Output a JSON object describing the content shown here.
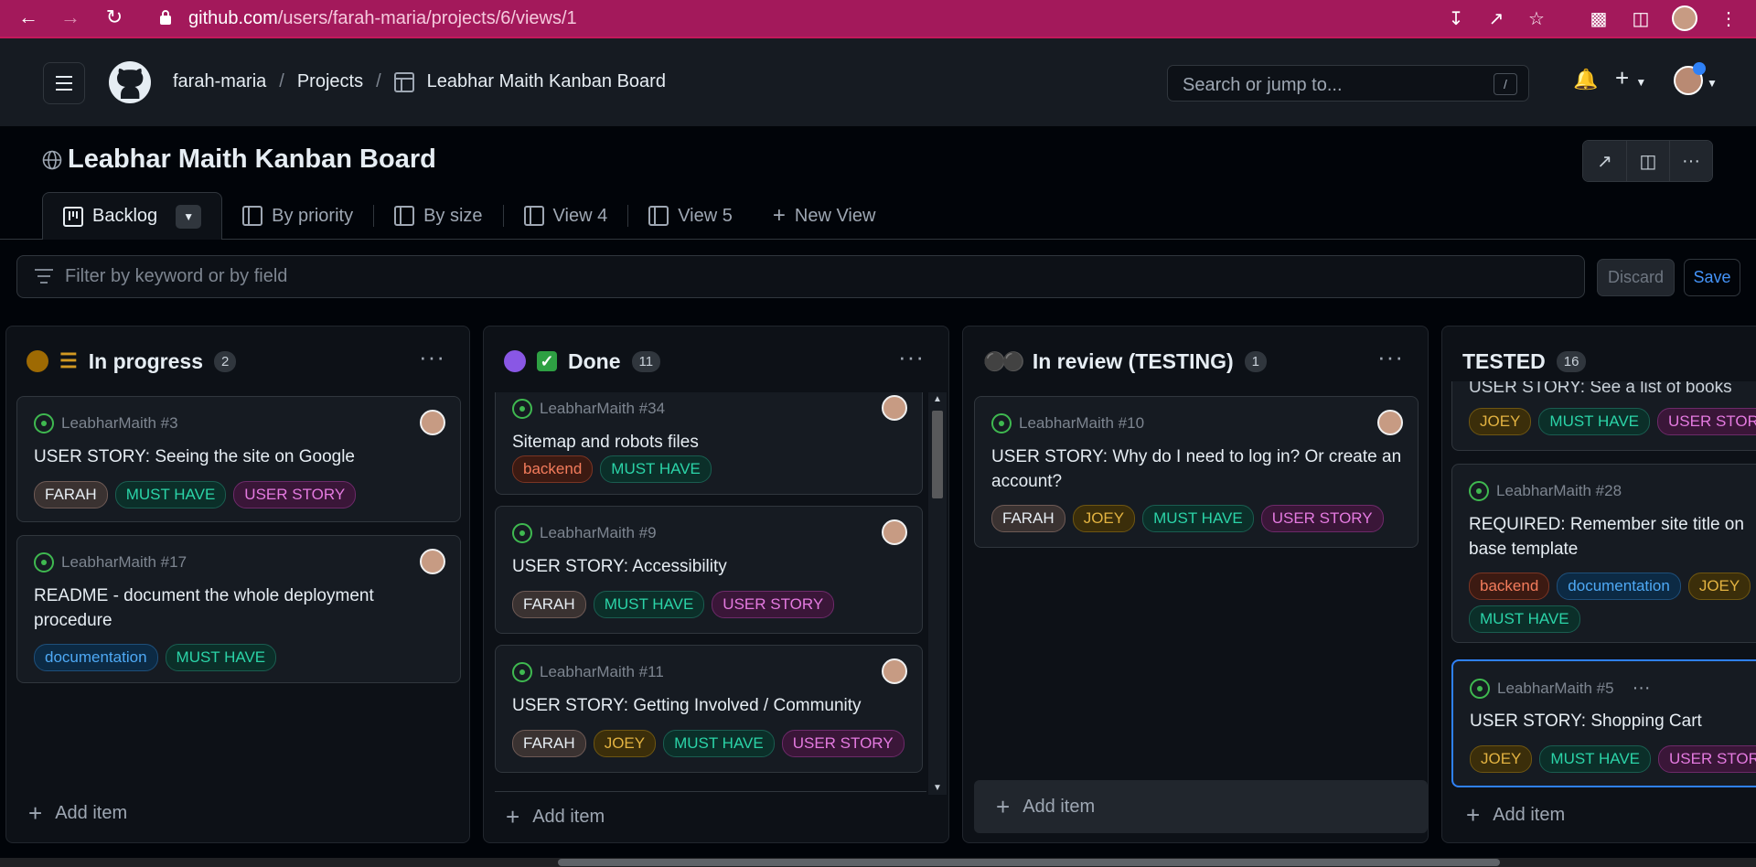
{
  "browser": {
    "url_host": "github.com",
    "url_path": "/users/farah-maria/projects/6/views/1"
  },
  "header": {
    "owner": "farah-maria",
    "projects": "Projects",
    "project_name": "Leabhar Maith Kanban Board",
    "search_placeholder": "Search or jump to...",
    "search_shortcut": "/"
  },
  "project": {
    "title": "Leabhar Maith Kanban Board",
    "tabs": [
      {
        "label": "Backlog"
      },
      {
        "label": "By priority"
      },
      {
        "label": "By size"
      },
      {
        "label": "View 4"
      },
      {
        "label": "View 5"
      },
      {
        "label": "New View"
      }
    ],
    "filter_placeholder": "Filter by keyword or by field",
    "discard": "Discard",
    "save": "Save"
  },
  "colors": {
    "in_progress": "#9e6a03",
    "done": "#8957e5"
  },
  "board": {
    "add_item": "Add item",
    "columns": [
      {
        "name": "In progress",
        "count": "2",
        "cards": [
          {
            "ref": "LeabharMaith #3",
            "title": "USER STORY: Seeing the site on Google",
            "labels": [
              "FARAH",
              "MUST HAVE",
              "USER STORY"
            ]
          },
          {
            "ref": "LeabharMaith #17",
            "title": "README - document the whole deployment procedure",
            "labels": [
              "documentation",
              "MUST HAVE"
            ]
          }
        ]
      },
      {
        "name": "Done",
        "count": "11",
        "cards": [
          {
            "ref": "LeabharMaith #34",
            "title": "Sitemap and robots files",
            "labels": [
              "backend",
              "MUST HAVE"
            ]
          },
          {
            "ref": "LeabharMaith #9",
            "title": "USER STORY: Accessibility",
            "labels": [
              "FARAH",
              "MUST HAVE",
              "USER STORY"
            ]
          },
          {
            "ref": "LeabharMaith #11",
            "title": "USER STORY: Getting Involved / Community",
            "labels": [
              "FARAH",
              "JOEY",
              "MUST HAVE",
              "USER STORY"
            ]
          }
        ]
      },
      {
        "name": "In review (TESTING)",
        "count": "1",
        "cards": [
          {
            "ref": "LeabharMaith #10",
            "title": "USER STORY: Why do I need to log in? Or create an account?",
            "labels": [
              "FARAH",
              "JOEY",
              "MUST HAVE",
              "USER STORY"
            ]
          }
        ]
      },
      {
        "name": "TESTED",
        "count": "16",
        "cards": [
          {
            "ref": "",
            "title": "USER STORY: See a list of books",
            "labels": [
              "JOEY",
              "MUST HAVE",
              "USER STORY"
            ]
          },
          {
            "ref": "LeabharMaith #28",
            "title": "REQUIRED: Remember site title on base template",
            "labels": [
              "backend",
              "documentation",
              "JOEY",
              "MUST HAVE"
            ]
          },
          {
            "ref": "LeabharMaith #5",
            "title": "USER STORY: Shopping Cart",
            "labels": [
              "JOEY",
              "MUST HAVE",
              "USER STORY"
            ]
          }
        ]
      }
    ]
  }
}
